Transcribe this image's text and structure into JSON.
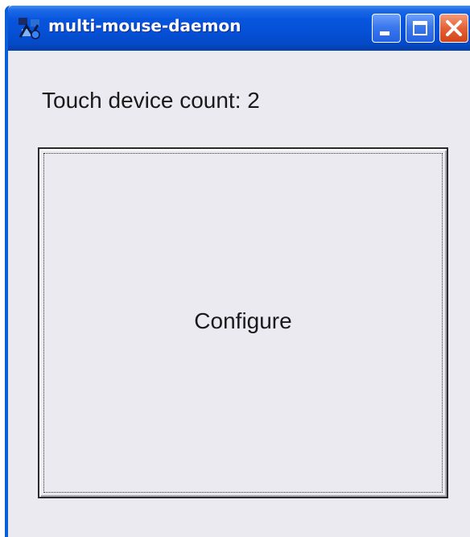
{
  "window": {
    "title": "multi-mouse-daemon",
    "icon": "app-icon",
    "controls": {
      "minimize_icon": "minimize-icon",
      "maximize_icon": "maximize-icon",
      "close_icon": "close-icon"
    }
  },
  "main": {
    "touch_device_count_label": "Touch device count: 2",
    "configure_button_label": "Configure"
  },
  "colors": {
    "titlebar": "#0550d6",
    "close_button": "#e56135",
    "window_background": "#eceaf1"
  }
}
